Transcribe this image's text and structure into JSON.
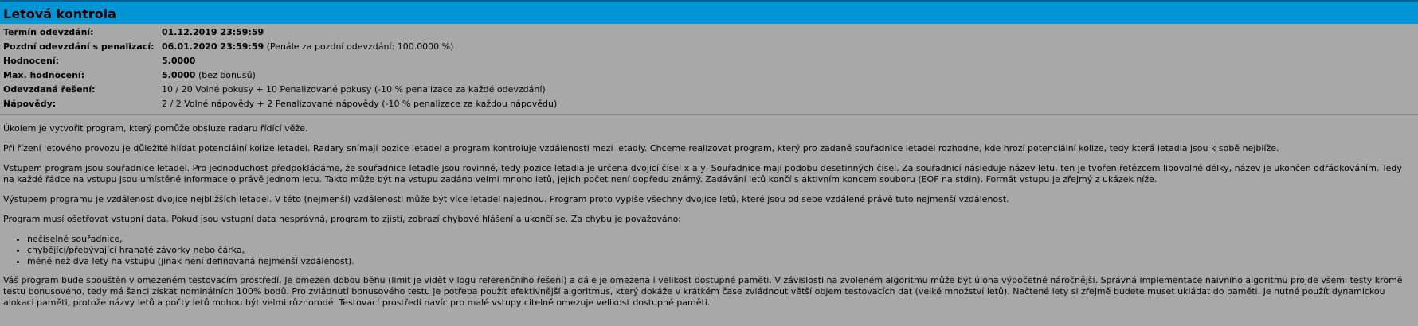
{
  "title": "Letová kontrola",
  "info": {
    "deadline_label": "Termín odevzdání:",
    "deadline_value": "01.12.2019 23:59:59",
    "late_label": "Pozdní odevzdání s penalizací:",
    "late_value": "06.01.2020 23:59:59",
    "late_note": "(Penále za pozdní odevzdání: 100.0000 %)",
    "rating_label": "Hodnocení:",
    "rating_value": "5.0000",
    "max_label": "Max. hodnocení:",
    "max_value": "5.0000",
    "max_note": "(bez bonusů)",
    "submitted_label": "Odevzdaná řešení:",
    "submitted_value": "10 / 20 Volné pokusy + 10 Penalizované pokusy (-10 % penalizace za každé odevzdání)",
    "hints_label": "Nápovědy:",
    "hints_value": "2 / 2 Volné nápovědy + 2 Penalizované nápovědy (-10 % penalizace za každou nápovědu)"
  },
  "content": {
    "p1": "Úkolem je vytvořit program, který pomůže obsluze radaru řídící věže.",
    "p2": "Při řízení letového provozu je důležité hlídat potenciální kolize letadel. Radary snímají pozice letadel a program kontroluje vzdálenosti mezi letadly. Chceme realizovat program, který pro zadané souřadnice letadel rozhodne, kde hrozí potenciální kolize, tedy která letadla jsou k sobě nejblíže.",
    "p3a": "Vstupem program jsou souřadnice letadel. Pro jednoduchost předpokládáme, že souřadnice letadle jsou rovinné, tedy pozice letadla je určena dvojicí čísel",
    "p3_x": "x",
    "p3_a": "a",
    "p3_y": "y",
    "p3b": ". Souřadnice mají podobu desetinných čísel. Za souřadnicí následuje název letu, ten je tvořen řetězcem libovolné délky, název je ukončen odřádkováním. Tedy na každé řádce na vstupu jsou umístěné informace o právě jednom letu. Takto může být na vstupu zadáno velmi mnoho letů, jejich počet není dopředu známý. Zadávání letů končí s aktivním koncem souboru (EOF na stdin). Formát vstupu je zřejmý z ukázek níže.",
    "p4": "Výstupem programu je vzdálenost dvojice nejbližších letadel. V této (nejmenší) vzdálenosti může být více letadel najednou. Program proto vypíše všechny dvojice letů, které jsou od sebe vzdálené právě tuto nejmenší vzdálenost.",
    "p5": "Program musí ošetřovat vstupní data. Pokud jsou vstupní data nesprávná, program to zjistí, zobrazí chybové hlášení a ukončí se. Za chybu je považováno:",
    "errors": [
      "nečíselné souřadnice,",
      "chybějící/přebývající hranaté závorky nebo čárka,",
      "méně než dva lety na vstupu (jinak není definovaná nejmenší vzdálenost)."
    ],
    "p6": "Váš program bude spouštěn v omezeném testovacím prostředí. Je omezen dobou běhu (limit je vidět v logu referenčního řešení) a dále je omezena i velikost dostupné paměti. V závislosti na zvoleném algoritmu může být úloha výpočetně náročnější. Správná implementace naivního algoritmu projde všemi testy kromě testu bonusového, tedy má šanci získat nominálních 100% bodů. Pro zvládnutí bonusového testu je potřeba použít efektivnější algoritmus, který dokáže v krátkém čase zvládnout větší objem testovacích dat (velké množství letů). Načtené lety si zřejmě budete muset ukládat do paměti. Je nutné použít dynamickou alokaci paměti, protože názvy letů a počty letů mohou být velmi různorodé. Testovací prostředí navíc pro malé vstupy citelně omezuje velikost dostupné paměti."
  }
}
